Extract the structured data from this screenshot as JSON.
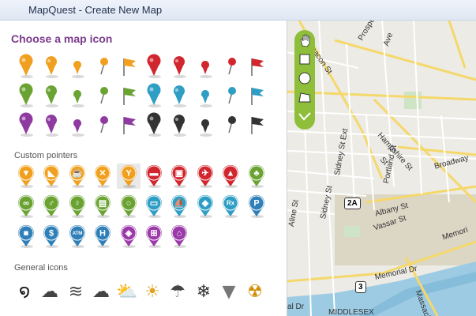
{
  "window": {
    "title": "MapQuest - Create New Map"
  },
  "panel": {
    "heading": "Choose a map icon",
    "sections": {
      "custom": "Custom pointers",
      "general": "General icons"
    }
  },
  "colors": {
    "orange": "#f0a01e",
    "green": "#6aa332",
    "purple": "#8e3aa0",
    "red": "#d1262e",
    "teal": "#2f9ec4",
    "black": "#333333",
    "blue": "#2f7fb8",
    "magenta": "#9b3aa8"
  },
  "map_icons": [
    {
      "name": "orange-pin-large",
      "color": "orange",
      "shape": "pin-l"
    },
    {
      "name": "orange-pin-medium",
      "color": "orange",
      "shape": "pin-m"
    },
    {
      "name": "orange-pin-small",
      "color": "orange",
      "shape": "pin-s"
    },
    {
      "name": "orange-pin-needle",
      "color": "orange",
      "shape": "needle"
    },
    {
      "name": "orange-flag",
      "color": "orange",
      "shape": "flag"
    },
    {
      "name": "red-pin-large",
      "color": "red",
      "shape": "pin-l"
    },
    {
      "name": "red-pin-medium",
      "color": "red",
      "shape": "pin-m"
    },
    {
      "name": "red-pin-small",
      "color": "red",
      "shape": "pin-s"
    },
    {
      "name": "red-pin-needle",
      "color": "red",
      "shape": "needle"
    },
    {
      "name": "red-flag",
      "color": "red",
      "shape": "flag"
    },
    {
      "name": "green-pin-large",
      "color": "green",
      "shape": "pin-l"
    },
    {
      "name": "green-pin-medium",
      "color": "green",
      "shape": "pin-m"
    },
    {
      "name": "green-pin-small",
      "color": "green",
      "shape": "pin-s"
    },
    {
      "name": "green-pin-needle",
      "color": "green",
      "shape": "needle"
    },
    {
      "name": "green-flag",
      "color": "green",
      "shape": "flag"
    },
    {
      "name": "teal-pin-large",
      "color": "teal",
      "shape": "pin-l"
    },
    {
      "name": "teal-pin-medium",
      "color": "teal",
      "shape": "pin-m"
    },
    {
      "name": "teal-pin-small",
      "color": "teal",
      "shape": "pin-s"
    },
    {
      "name": "teal-pin-needle",
      "color": "teal",
      "shape": "needle"
    },
    {
      "name": "teal-flag",
      "color": "teal",
      "shape": "flag"
    },
    {
      "name": "purple-pin-large",
      "color": "purple",
      "shape": "pin-l"
    },
    {
      "name": "purple-pin-medium",
      "color": "purple",
      "shape": "pin-m"
    },
    {
      "name": "purple-pin-small",
      "color": "purple",
      "shape": "pin-s"
    },
    {
      "name": "purple-pin-needle",
      "color": "purple",
      "shape": "needle"
    },
    {
      "name": "purple-flag",
      "color": "purple",
      "shape": "flag"
    },
    {
      "name": "black-pin-large",
      "color": "black",
      "shape": "pin-l"
    },
    {
      "name": "black-pin-medium",
      "color": "black",
      "shape": "pin-m"
    },
    {
      "name": "black-pin-small",
      "color": "black",
      "shape": "pin-s"
    },
    {
      "name": "black-pin-needle",
      "color": "black",
      "shape": "needle"
    },
    {
      "name": "black-flag",
      "color": "black",
      "shape": "flag"
    }
  ],
  "custom_pointers": [
    {
      "name": "ice-cream-pointer-icon",
      "color": "orange",
      "glyph": "▼",
      "selected": false
    },
    {
      "name": "pizza-pointer-icon",
      "color": "orange",
      "glyph": "◣",
      "selected": false
    },
    {
      "name": "coffee-pointer-icon",
      "color": "orange",
      "glyph": "☕",
      "selected": false
    },
    {
      "name": "restaurant-pointer-icon",
      "color": "orange",
      "glyph": "✕",
      "selected": false
    },
    {
      "name": "bar-pointer-icon",
      "color": "orange",
      "glyph": "Y",
      "selected": true
    },
    {
      "name": "hotel-pointer-icon",
      "color": "red",
      "glyph": "▬",
      "selected": false
    },
    {
      "name": "car-pointer-icon",
      "color": "red",
      "glyph": "▣",
      "selected": false
    },
    {
      "name": "airport-pointer-icon",
      "color": "red",
      "glyph": "✈",
      "selected": false
    },
    {
      "name": "camping-pointer-icon",
      "color": "red",
      "glyph": "▲",
      "selected": false
    },
    {
      "name": "park-pointer-icon",
      "color": "green",
      "glyph": "♣",
      "selected": false
    },
    {
      "name": "bicycle-pointer-icon",
      "color": "green",
      "glyph": "∞",
      "selected": false
    },
    {
      "name": "running-pointer-icon",
      "color": "green",
      "glyph": "♂",
      "selected": false
    },
    {
      "name": "hiking-pointer-icon",
      "color": "green",
      "glyph": "♀",
      "selected": false
    },
    {
      "name": "cinema-pointer-icon",
      "color": "green",
      "glyph": "▤",
      "selected": false
    },
    {
      "name": "search-pointer-icon",
      "color": "green",
      "glyph": "○",
      "selected": false
    },
    {
      "name": "card-pointer-icon",
      "color": "teal",
      "glyph": "▭",
      "selected": false
    },
    {
      "name": "boat-pointer-icon",
      "color": "teal",
      "glyph": "⛵",
      "selected": false
    },
    {
      "name": "school-pointer-icon",
      "color": "teal",
      "glyph": "◆",
      "selected": false
    },
    {
      "name": "pharmacy-pointer-icon",
      "color": "teal",
      "glyph": "Rx",
      "selected": false
    },
    {
      "name": "parking-pointer-icon",
      "color": "blue",
      "glyph": "P",
      "selected": false
    },
    {
      "name": "gas-station-pointer-icon",
      "color": "blue",
      "glyph": "■",
      "selected": false
    },
    {
      "name": "bank-pointer-icon",
      "color": "blue",
      "glyph": "$",
      "selected": false
    },
    {
      "name": "atm-pointer-icon",
      "color": "blue",
      "glyph": "ATM",
      "selected": false
    },
    {
      "name": "hospital-pointer-icon",
      "color": "blue",
      "glyph": "H",
      "selected": false
    },
    {
      "name": "tag-pointer-icon",
      "color": "magenta",
      "glyph": "◈",
      "selected": false
    },
    {
      "name": "shopping-cart-pointer-icon",
      "color": "magenta",
      "glyph": "⊞",
      "selected": false
    },
    {
      "name": "clothes-hanger-pointer-icon",
      "color": "magenta",
      "glyph": "⌂",
      "selected": false
    }
  ],
  "general_icons": [
    {
      "name": "hurricane-icon",
      "glyph": "໑",
      "color": "#111111"
    },
    {
      "name": "snow-cloud-icon",
      "glyph": "☁",
      "color": "#444444"
    },
    {
      "name": "wind-waves-icon",
      "glyph": "≋",
      "color": "#444444"
    },
    {
      "name": "cloud-icon",
      "glyph": "☁",
      "color": "#444444"
    },
    {
      "name": "partly-sunny-icon",
      "glyph": "⛅",
      "color": "#e0a020"
    },
    {
      "name": "sun-icon",
      "glyph": "☀",
      "color": "#e0a020"
    },
    {
      "name": "rain-cloud-icon",
      "glyph": "☂",
      "color": "#444444"
    },
    {
      "name": "snowflake-icon",
      "glyph": "❄",
      "color": "#333333"
    },
    {
      "name": "tornado-icon",
      "glyph": "▼",
      "color": "#777777"
    },
    {
      "name": "radiation-icon",
      "glyph": "☢",
      "color": "#d08a00"
    }
  ],
  "map": {
    "labels": [
      {
        "name": "street-label-beacon",
        "text": "Beacon St"
      },
      {
        "name": "street-label-prospect",
        "text": "Prospect St"
      },
      {
        "name": "street-label-ave",
        "text": "Ave"
      },
      {
        "name": "street-label-hampshire",
        "text": "Hampshire St"
      },
      {
        "name": "street-label-broadway",
        "text": "Broadway"
      },
      {
        "name": "street-label-st",
        "text": "St"
      },
      {
        "name": "street-label-sidney-ext",
        "text": "Sidney St Ext"
      },
      {
        "name": "street-label-sidney",
        "text": "Sidney St"
      },
      {
        "name": "street-label-portland",
        "text": "Portland St"
      },
      {
        "name": "street-label-albany",
        "text": "Albany St"
      },
      {
        "name": "street-label-vassar",
        "text": "Vassar St"
      },
      {
        "name": "street-label-aline",
        "text": "Aline St"
      },
      {
        "name": "street-label-memorial",
        "text": "Memorial Dr"
      },
      {
        "name": "street-label-memoria",
        "text": "Memori"
      },
      {
        "name": "street-label-massach",
        "text": "Massach"
      },
      {
        "name": "street-label-dr",
        "text": "al Dr"
      },
      {
        "name": "street-label-middlesex",
        "text": "MIDDLESEX"
      }
    ],
    "shields": [
      {
        "name": "route-2a-shield",
        "text": "2A"
      },
      {
        "name": "route-3-shield",
        "text": "3"
      }
    ],
    "tools": [
      {
        "name": "pan-hand-tool-icon"
      },
      {
        "name": "rectangle-draw-tool-icon"
      },
      {
        "name": "circle-draw-tool-icon"
      },
      {
        "name": "polygon-draw-tool-icon"
      },
      {
        "name": "line-draw-tool-icon"
      }
    ]
  }
}
